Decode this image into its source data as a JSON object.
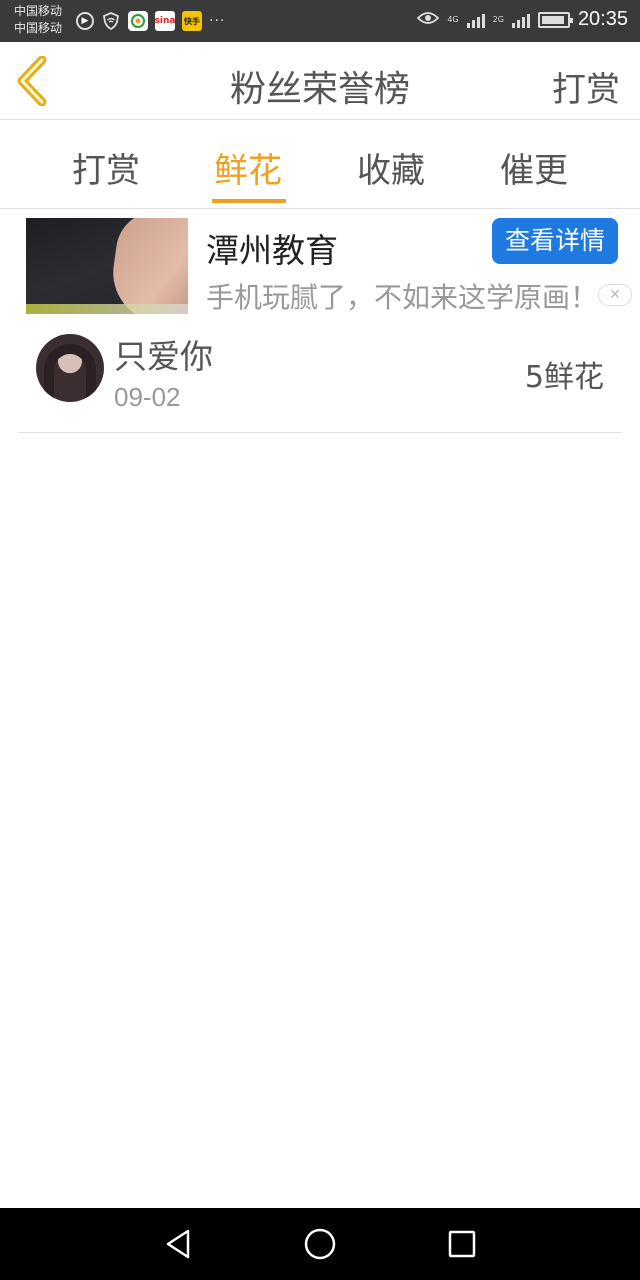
{
  "status_bar": {
    "carrier_1": "中国移动",
    "carrier_2": "中国移动",
    "network_1": "4G",
    "network_2": "2G",
    "time": "20:35",
    "icons": [
      "play-circle-icon",
      "shield-wifi-icon",
      "browser-app-icon",
      "sina-weibo-icon",
      "kuaishou-app-icon",
      "more-dots-icon",
      "eye-comfort-icon",
      "signal-icon",
      "battery-icon"
    ]
  },
  "header": {
    "title": "粉丝荣誉榜",
    "right_action": "打赏",
    "back_icon": "chevron-left-icon"
  },
  "tabs": {
    "items": [
      {
        "label": "打赏",
        "active": false
      },
      {
        "label": "鲜花",
        "active": true
      },
      {
        "label": "收藏",
        "active": false
      },
      {
        "label": "催更",
        "active": false
      }
    ],
    "active_color": "#f0a020"
  },
  "ad": {
    "title": "潭州教育",
    "description": "手机玩腻了，不如来这学原画！",
    "button_label": "查看详情",
    "button_color": "#1e7ae0"
  },
  "list": [
    {
      "name": "只爱你",
      "date": "09-02",
      "gift": "5鲜花"
    }
  ],
  "nav_bar": {
    "icons": [
      "back-triangle-icon",
      "home-circle-icon",
      "recents-square-icon"
    ]
  }
}
